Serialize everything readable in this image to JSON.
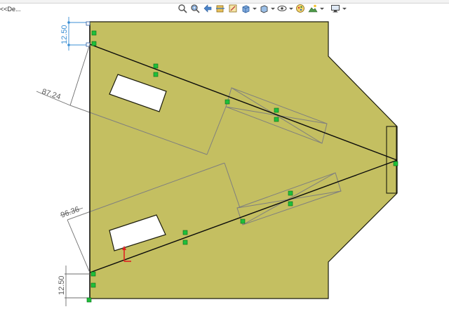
{
  "feature_tree": {
    "label": "<<De..."
  },
  "toolbar": {
    "buttons": [
      {
        "name": "zoom-to-fit-icon"
      },
      {
        "name": "zoom-to-area-icon"
      },
      {
        "name": "previous-view-icon"
      },
      {
        "name": "section-view-icon"
      },
      {
        "name": "dynamic-annotation-icon"
      },
      {
        "name": "view-orientation-icon"
      },
      {
        "name": "display-style-icon"
      },
      {
        "name": "hide-show-items-icon"
      },
      {
        "name": "edit-appearance-icon"
      },
      {
        "name": "apply-scene-icon"
      },
      {
        "name": "view-settings-icon"
      }
    ]
  },
  "dimensions": {
    "top_offset": "12.50",
    "upper_link_length": "87.24",
    "lower_link_length": "96.36",
    "bottom_offset": "12.50"
  },
  "colors": {
    "plate_fill": "#c4bf61",
    "plate_edge": "#1c1c0c",
    "sketch_line": "#0a0a0a",
    "construction_line": "#7f7f7f",
    "relation_glyph": "#1fbf3a",
    "dimension_blue": "#3b8fd4",
    "dimension_gray": "#6d6d6d",
    "origin_red": "#e02020"
  }
}
